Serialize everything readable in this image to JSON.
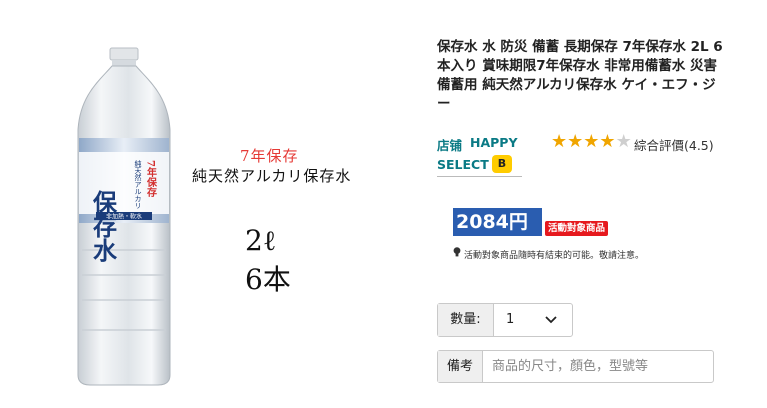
{
  "product": {
    "title": "保存水 水 防災 備蓄 長期保存 7年保存水 2L 6本入り 賞味期限7年保存水 非常用備蓄水 災害備蓄用 純天然アルカリ保存水 ケイ・エフ・ジー",
    "image": {
      "label_main": "保存水",
      "label_side": "純天然アルカリ",
      "label_years": "7年保存",
      "label_bottom": "非加熱・軟水",
      "promo_line1": "7年保存",
      "promo_line2": "純天然アルカリ保存水",
      "promo_volume": "2ℓ",
      "promo_count": "6本"
    }
  },
  "store": {
    "label": "店铺",
    "name_part1": "HAPPY",
    "name_part2": "SELECT",
    "badge": "B"
  },
  "rating": {
    "stars_filled": 4,
    "stars_total": 5,
    "text": "綜合評價(4.5)",
    "color": "#f0a500"
  },
  "price": {
    "value": "2084円",
    "event_badge": "活動對象商品",
    "note": "活動對象商品隨時有結束的可能。敬請注意。",
    "accent": "#2a5db0",
    "badge_color": "#e6191e"
  },
  "quantity": {
    "label": "數量:",
    "value": "1"
  },
  "remark": {
    "label": "備考",
    "placeholder": "商品的尺寸，顏色，型號等"
  }
}
